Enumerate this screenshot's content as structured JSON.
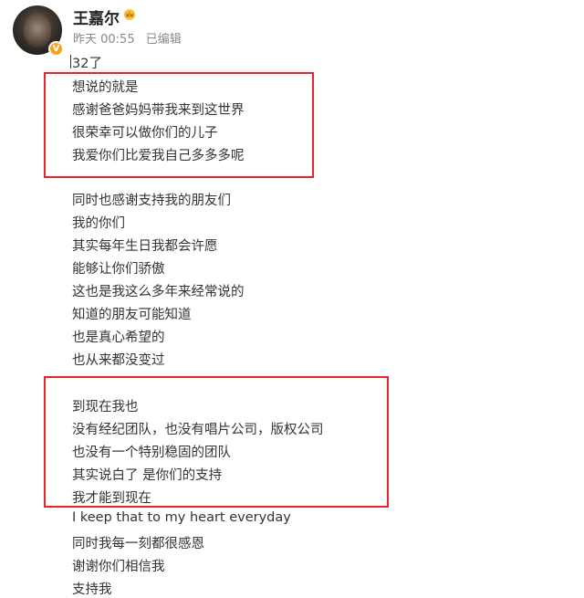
{
  "post": {
    "username": "王嘉尔",
    "time": "昨天 00:55",
    "edited": "已编辑",
    "lines": [
      "32了",
      "想说的就是",
      "感谢爸爸妈妈带我来到这世界",
      "很荣幸可以做你们的儿子",
      "我爱你们比爱我自己多多多呢",
      "同时也感谢支持我的朋友们",
      "我的你们",
      "其实每年生日我都会许愿",
      "能够让你们骄傲",
      "这也是我这么多年来经常说的",
      "知道的朋友可能知道",
      "也是真心希望的",
      "也从来都没变过",
      "到现在我也",
      "没有经纪团队，也没有唱片公司，版权公司",
      "也没有一个特别稳固的团队",
      "其实说白了 是你们的支持",
      "我才能到现在",
      "I keep that to my heart everyday",
      "同时我每一刻都很感恩",
      "谢谢你们相信我",
      "支持我"
    ]
  },
  "icons": {
    "avatar": "avatar-image",
    "verified": "verified-v-badge-icon",
    "crown": "crown-icon"
  },
  "colors": {
    "highlight_box": "#e8232c",
    "meta_text": "#8a8a8a",
    "verified_badge": "#f7a21b"
  }
}
